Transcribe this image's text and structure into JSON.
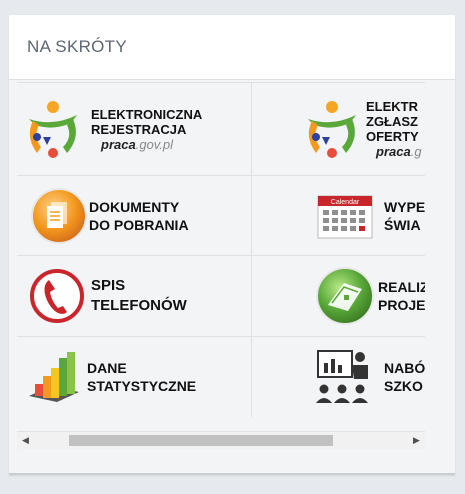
{
  "panel": {
    "title": "NA SKRÓTY"
  },
  "shortcuts": {
    "erejestracja": {
      "line1": "ELEKTRONICZNA",
      "line2": "REJESTRACJA",
      "sub_a": "praca",
      "sub_b": ".gov.pl"
    },
    "ezgloszenie": {
      "line1": "ELEKTR",
      "line2": "ZGŁASZ",
      "line3": "OFERTY",
      "sub_a": "praca",
      "sub_b": ".g"
    },
    "dokumenty": {
      "line1": "DOKUMENTY",
      "line2": "DO POBRANIA"
    },
    "wypelnij": {
      "line1": "WYPE",
      "line2": "ŚWIA",
      "calendar_word": "Calendar"
    },
    "spis": {
      "line1": "SPIS",
      "line2": "TELEFONÓW"
    },
    "realizacja": {
      "line1": "REALIZ",
      "line2": "PROJE"
    },
    "dane": {
      "line1": "DANE",
      "line2": "STATYSTYCZNE"
    },
    "nabor": {
      "line1": "NABÓ",
      "line2": "SZKO"
    }
  },
  "scrollbar": {
    "left_arrow": "◀",
    "right_arrow": "▶",
    "position": 0.12
  },
  "colors": {
    "accent_green": "#5aa83a",
    "accent_orange": "#f39a1e",
    "accent_red": "#c8262b"
  }
}
